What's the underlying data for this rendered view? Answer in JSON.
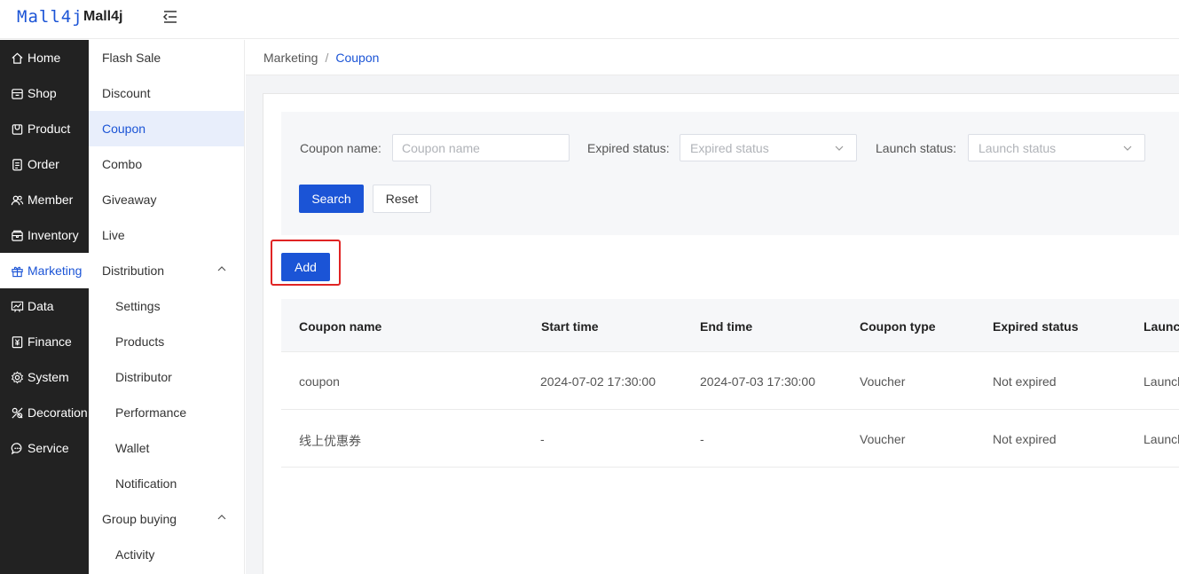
{
  "header": {
    "logo_mark": "Mall4j",
    "app_name": "Mall4j"
  },
  "primary_nav": [
    {
      "label": "Home",
      "icon": "home-icon"
    },
    {
      "label": "Shop",
      "icon": "shop-icon"
    },
    {
      "label": "Product",
      "icon": "product-icon"
    },
    {
      "label": "Order",
      "icon": "order-icon"
    },
    {
      "label": "Member",
      "icon": "member-icon"
    },
    {
      "label": "Inventory",
      "icon": "inventory-icon"
    },
    {
      "label": "Marketing",
      "icon": "gift-icon",
      "active": true
    },
    {
      "label": "Data",
      "icon": "chart-icon"
    },
    {
      "label": "Finance",
      "icon": "finance-icon"
    },
    {
      "label": "System",
      "icon": "gear-icon"
    },
    {
      "label": "Decoration",
      "icon": "decoration-icon"
    },
    {
      "label": "Service",
      "icon": "chat-icon"
    }
  ],
  "secondary_nav": [
    {
      "label": "Flash Sale",
      "level": 1
    },
    {
      "label": "Discount",
      "level": 1
    },
    {
      "label": "Coupon",
      "level": 1,
      "active": true
    },
    {
      "label": "Combo",
      "level": 1
    },
    {
      "label": "Giveaway",
      "level": 1
    },
    {
      "label": "Live",
      "level": 1
    },
    {
      "label": "Distribution",
      "level": 1,
      "expanded": true
    },
    {
      "label": "Settings",
      "level": 2
    },
    {
      "label": "Products",
      "level": 2
    },
    {
      "label": "Distributor",
      "level": 2
    },
    {
      "label": "Performance",
      "level": 2
    },
    {
      "label": "Wallet",
      "level": 2
    },
    {
      "label": "Notification",
      "level": 2
    },
    {
      "label": "Group buying",
      "level": 1,
      "expanded": true
    },
    {
      "label": "Activity",
      "level": 2
    }
  ],
  "breadcrumb": {
    "parent": "Marketing",
    "separator": "/",
    "current": "Coupon"
  },
  "search": {
    "coupon_name_label": "Coupon name:",
    "coupon_name_placeholder": "Coupon name",
    "expired_status_label": "Expired status:",
    "expired_status_placeholder": "Expired status",
    "launch_status_label": "Launch status:",
    "launch_status_placeholder": "Launch status",
    "search_label": "Search",
    "reset_label": "Reset"
  },
  "actions": {
    "add_label": "Add"
  },
  "table": {
    "columns": [
      "Coupon name",
      "Start time",
      "End time",
      "Coupon type",
      "Expired status",
      "Launch status"
    ],
    "rows": [
      [
        "coupon",
        "2024-07-02 17:30:00",
        "2024-07-03 17:30:00",
        "Voucher",
        "Not expired",
        "Launched"
      ],
      [
        "线上优惠券",
        "-",
        "-",
        "Voucher",
        "Not expired",
        "Launched"
      ]
    ]
  },
  "colors": {
    "primary": "#1b54d6",
    "sidebar_bg": "#222222",
    "highlight": "#e02424"
  }
}
